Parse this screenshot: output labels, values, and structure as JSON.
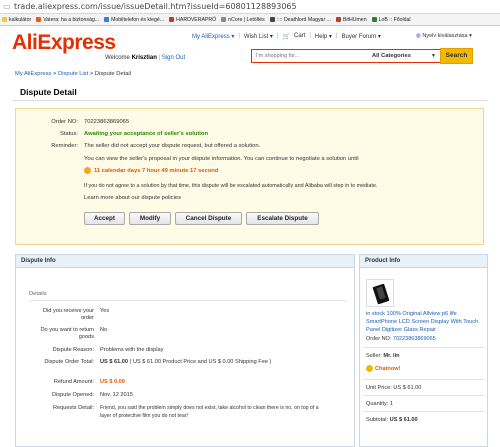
{
  "browser": {
    "url": "trade.aliexpress.com/issue/issueDetail.htm?issueId=60801128893065",
    "bookmarks": [
      {
        "label": "kalkulátor",
        "color": "#f2c744"
      },
      {
        "label": "Vatera: ha a biztonság...",
        "color": "#e85c1b"
      },
      {
        "label": "Mobiltelefon és kiegé...",
        "color": "#3b7dd8"
      },
      {
        "label": "HARDVERAPRÓ",
        "color": "#c0392b"
      },
      {
        "label": "nCore | Letöltés",
        "color": "#888888"
      },
      {
        "label": ":::: Deathlord Magyar ...",
        "color": "#444444"
      },
      {
        "label": "BitHUmen",
        "color": "#c0392b"
      },
      {
        "label": "LoB :: Főoldal",
        "color": "#2e7d32"
      }
    ]
  },
  "header": {
    "logo": "AliExpress",
    "nav": [
      "My AliExpress ▾",
      "Wish List ▾",
      "Cart",
      "Help ▾",
      "Buyer Forum ▾"
    ],
    "language": "Nyelv kiválasztása ▾",
    "welcome_prefix": "Welcome",
    "user": "Krisztian",
    "sign_out": "Sign Out",
    "search_placeholder": "I'm shopping for...",
    "category": "All Categories",
    "search_button": "Search"
  },
  "breadcrumb": {
    "root": "My AliExpress",
    "list": "Dispute List",
    "current": "Dispute Detail"
  },
  "page_title": "Dispute Detail",
  "summary": {
    "order_label": "Order NO:",
    "order_no": "70223863869065",
    "status_label": "Status:",
    "status": "Awaiting your acceptance of seller's solution",
    "reminder_label": "Reminder:",
    "reminder": "The seller did not accept your dispute request, but offered a solution.",
    "line2": "You can view the seller's proposal in your dispute information. You can continue to negotiate a solution until",
    "countdown": "11 calendar days 7 hour 49 minute 17 second",
    "line3": "If you do not agree to a solution by that time, this dispute will be escalated automatically and Alibaba will step in to mediate.",
    "learn_more": "Learn more about our dispute policies",
    "buttons": [
      "Accept",
      "Modify",
      "Cancel Dispute",
      "Escalate Dispute"
    ]
  },
  "dispute_info": {
    "title": "Dispute Info",
    "details": "Details",
    "rows": [
      {
        "label": "Did you receive your order",
        "value": "Yes"
      },
      {
        "label": "Do you want to return goods",
        "value": "No"
      },
      {
        "label": "Dispute Reason:",
        "value": "Problems with the display"
      },
      {
        "label": "Dispute Order Total:",
        "value": "US $ 61.00",
        "extra": "( US $ 61.00 Product Price and US $ 0.00 Shipping Fee )"
      },
      {
        "label": "Refund Amount:",
        "value": "US $ 0.00"
      },
      {
        "label": "Dispute Opened:",
        "value": "Nov. 12 2015"
      },
      {
        "label": "Requests Detail:",
        "value": "Friend, you said the problem simply does not exist, take alcohol to clean there is no, on top of a",
        "value2": "layer of protective film you do not tear!"
      }
    ]
  },
  "product_info": {
    "title": "Product Info",
    "name": "in stock 100% Original Allview p6 life SmartPhone LCD Screen Display With Touch Panel Digitizer Glass Repair",
    "order_label": "Order NO:",
    "order_no": "70223863869065",
    "seller_label": "Seller:",
    "seller": "Mr. lin",
    "chat": "Chatnow!",
    "unit_price": "Unit Price: US $ 61.00",
    "quantity": "Quantity: 1",
    "subtotal_label": "Subtotal:",
    "subtotal": "US $ 61.00"
  }
}
